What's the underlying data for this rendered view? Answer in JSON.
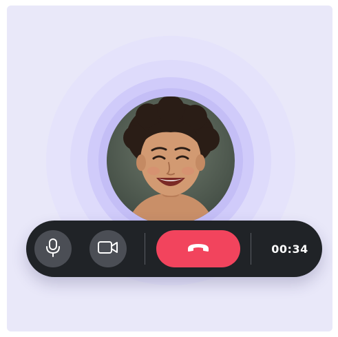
{
  "call": {
    "timer": "00:34"
  },
  "controls": {
    "mic_icon": "microphone-icon",
    "camera_icon": "video-camera-icon",
    "end_call_icon": "phone-hangup-icon"
  },
  "colors": {
    "background": "#e9e8f9",
    "call_bar": "#202327",
    "control_button": "#4b4e55",
    "end_call": "#f2445d",
    "pulse_ring": "#c4bef6"
  }
}
